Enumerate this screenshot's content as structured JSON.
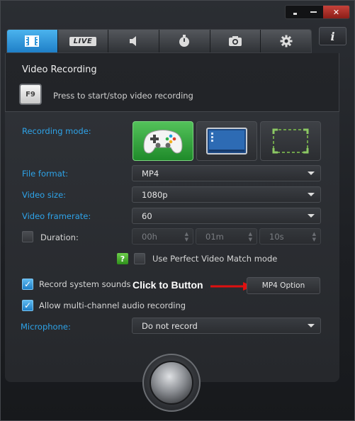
{
  "window": {
    "controls": [
      "restore-icon",
      "minimize-icon",
      "close-icon"
    ],
    "close_glyph": "✕",
    "info_glyph": "i"
  },
  "tabs": [
    {
      "icon": "film-icon",
      "active": true
    },
    {
      "icon": "live-icon",
      "label": "LIVE"
    },
    {
      "icon": "speaker-icon"
    },
    {
      "icon": "stopwatch-icon"
    },
    {
      "icon": "camera-icon"
    },
    {
      "icon": "gear-icon"
    }
  ],
  "section": {
    "title": "Video Recording",
    "hotkey": "F9",
    "hotkey_text": "Press to start/stop video recording"
  },
  "recording_mode": {
    "label": "Recording mode:",
    "options": [
      {
        "icon": "gamepad-icon",
        "active": true
      },
      {
        "icon": "desktop-icon"
      },
      {
        "icon": "region-icon"
      }
    ]
  },
  "file_format": {
    "label": "File format:",
    "value": "MP4"
  },
  "video_size": {
    "label": "Video size:",
    "value": "1080p"
  },
  "video_framerate": {
    "label": "Video framerate:",
    "value": "60"
  },
  "duration": {
    "label": "Duration:",
    "checked": false,
    "hours": "00h",
    "minutes": "01m",
    "seconds": "10s"
  },
  "perfect_match": {
    "help": "?",
    "label": "Use Perfect Video Match mode",
    "checked": false
  },
  "system_sounds": {
    "label": "Record system sounds",
    "checked": true
  },
  "mp4_option": {
    "label": "MP4 Option"
  },
  "annotation": {
    "text": "Click to Button",
    "color": "#e01010"
  },
  "multichannel": {
    "label": "Allow multi-channel audio recording",
    "checked": true
  },
  "microphone": {
    "label": "Microphone:",
    "value": "Do not record"
  },
  "colors": {
    "accent": "#2ea3e8",
    "active_green": "#3fae45",
    "tab_blue": "#2f93dc"
  }
}
